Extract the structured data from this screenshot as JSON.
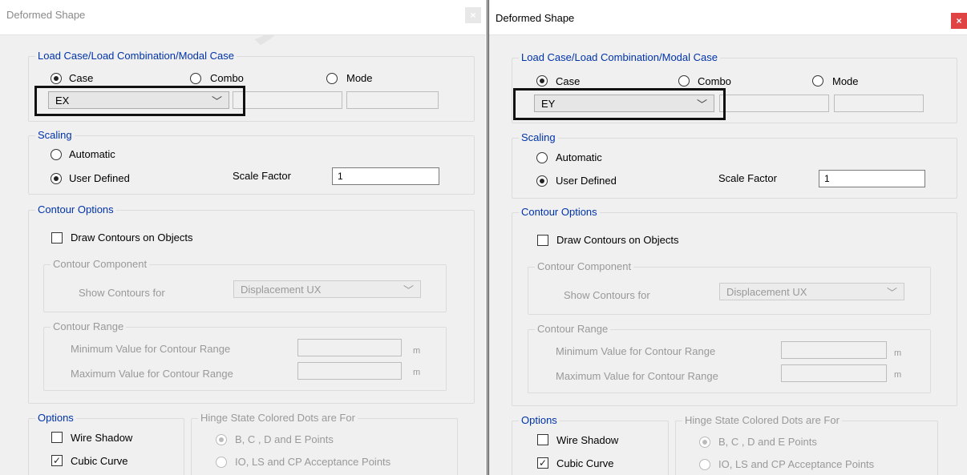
{
  "dialogs": [
    {
      "title": "Deformed Shape",
      "close_glyph": "×",
      "load_group": {
        "legend": "Load Case/Load Combination/Modal Case",
        "case_label": "Case",
        "combo_label": "Combo",
        "mode_label": "Mode",
        "selected": "case",
        "case_value": "EX"
      },
      "scaling": {
        "legend": "Scaling",
        "automatic_label": "Automatic",
        "user_defined_label": "User Defined",
        "selected": "user_defined",
        "scale_factor_label": "Scale Factor",
        "scale_factor_value": "1"
      },
      "contour_options": {
        "legend": "Contour Options",
        "draw_contours_label": "Draw Contours on Objects",
        "draw_contours_checked": false,
        "component": {
          "legend": "Contour Component",
          "show_for_label": "Show Contours for",
          "show_for_value": "Displacement UX"
        },
        "range": {
          "legend": "Contour Range",
          "min_label": "Minimum Value for Contour Range",
          "max_label": "Maximum Value for Contour Range",
          "unit": "m"
        }
      },
      "options": {
        "legend": "Options",
        "wire_shadow_label": "Wire Shadow",
        "wire_shadow_checked": false,
        "cubic_curve_label": "Cubic Curve",
        "cubic_curve_checked": true
      },
      "hinge": {
        "legend": "Hinge State Colored Dots are For",
        "bcde_label": "B, C , D and E Points",
        "io_ls_cp_label": "IO, LS and CP Acceptance Points"
      }
    },
    {
      "title": "Deformed Shape",
      "close_glyph": "×",
      "load_group": {
        "legend": "Load Case/Load Combination/Modal Case",
        "case_label": "Case",
        "combo_label": "Combo",
        "mode_label": "Mode",
        "selected": "case",
        "case_value": "EY"
      },
      "scaling": {
        "legend": "Scaling",
        "automatic_label": "Automatic",
        "user_defined_label": "User Defined",
        "selected": "user_defined",
        "scale_factor_label": "Scale Factor",
        "scale_factor_value": "1"
      },
      "contour_options": {
        "legend": "Contour Options",
        "draw_contours_label": "Draw Contours on Objects",
        "draw_contours_checked": false,
        "component": {
          "legend": "Contour Component",
          "show_for_label": "Show Contours for",
          "show_for_value": "Displacement UX"
        },
        "range": {
          "legend": "Contour Range",
          "min_label": "Minimum Value for Contour Range",
          "max_label": "Maximum Value for Contour Range",
          "unit": "m"
        }
      },
      "options": {
        "legend": "Options",
        "wire_shadow_label": "Wire Shadow",
        "wire_shadow_checked": false,
        "cubic_curve_label": "Cubic Curve",
        "cubic_curve_checked": true
      },
      "hinge": {
        "legend": "Hinge State Colored Dots are For",
        "bcde_label": "B, C , D and E Points",
        "io_ls_cp_label": "IO, LS and CP Acceptance Points"
      }
    }
  ],
  "watermark_text": "saze",
  "icons": {
    "dropdown": "chevron-down-icon",
    "close": "close-icon",
    "check": "check-icon"
  },
  "colors": {
    "accent_legend": "#0033aa",
    "close_active": "#e04343",
    "highlight_border": "#111111"
  }
}
